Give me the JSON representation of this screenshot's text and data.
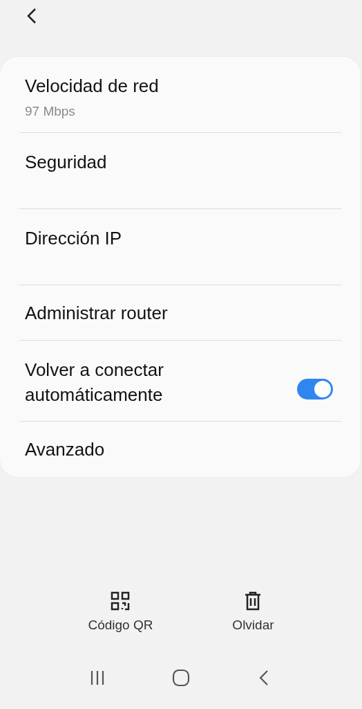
{
  "items": [
    {
      "kind": "info",
      "title": "Velocidad de red",
      "subtitle": "97 Mbps"
    },
    {
      "kind": "info",
      "title": "Seguridad"
    },
    {
      "kind": "info",
      "title": "Dirección IP"
    },
    {
      "kind": "link",
      "title": "Administrar router"
    },
    {
      "kind": "toggle",
      "title": "Volver a conectar automáticamente",
      "on": true
    },
    {
      "kind": "link",
      "title": "Avanzado"
    }
  ],
  "actions": [
    {
      "kind": "qr",
      "label": "Código QR"
    },
    {
      "kind": "delete",
      "label": "Olvidar"
    }
  ]
}
